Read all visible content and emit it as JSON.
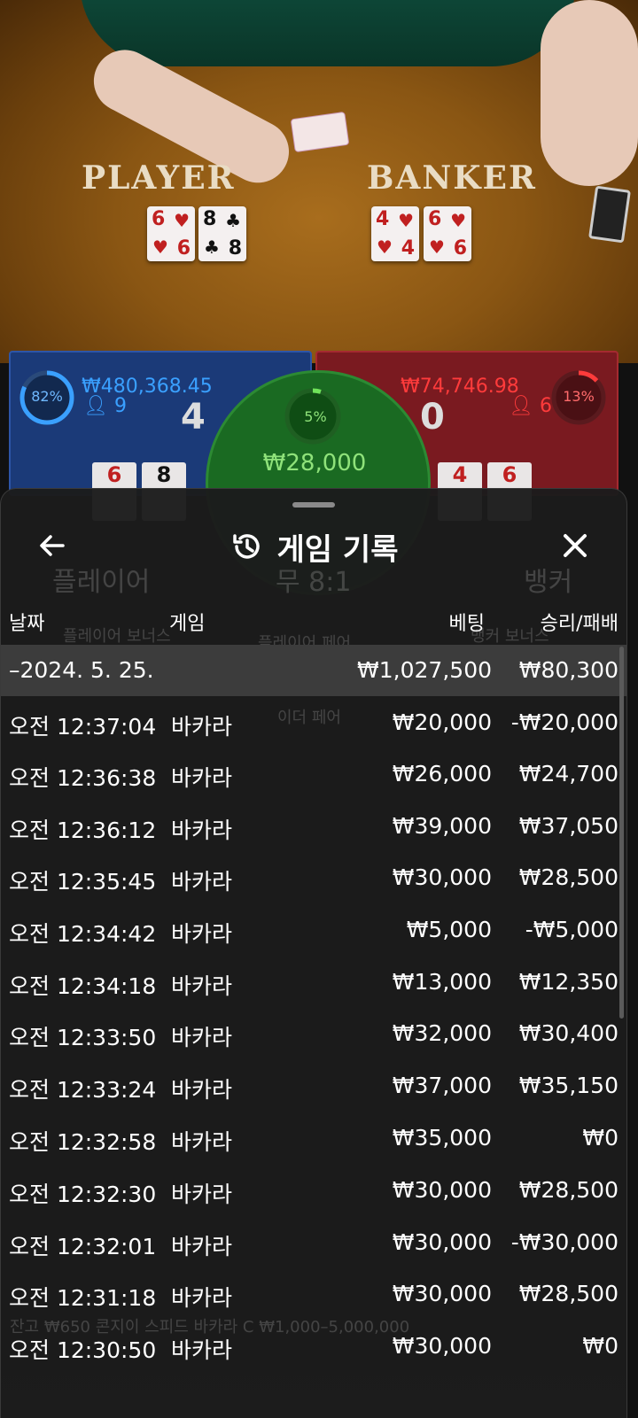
{
  "table": {
    "player_label": "PLAYER",
    "banker_label": "BANKER",
    "player_cards": [
      {
        "rank": "6",
        "suit": "♥",
        "color": "red"
      },
      {
        "rank": "8",
        "suit": "♣",
        "color": "black"
      }
    ],
    "banker_cards": [
      {
        "rank": "4",
        "suit": "♥",
        "color": "red"
      },
      {
        "rank": "6",
        "suit": "♥",
        "color": "red"
      }
    ]
  },
  "bets": {
    "player": {
      "percent": "82%",
      "amount": "₩480,368.45",
      "count": "9",
      "score": "4",
      "percent_value": 0.82,
      "color": "#3aa0ff"
    },
    "banker": {
      "percent": "13%",
      "amount": "₩74,746.98",
      "count": "6",
      "score": "0",
      "percent_value": 0.13,
      "color": "#ff3b3b"
    },
    "tie": {
      "percent": "5%",
      "amount": "₩28,000",
      "percent_value": 0.05,
      "color": "#6fe35a"
    },
    "player_mini_cards": [
      {
        "rank": "6",
        "suit": "♥"
      },
      {
        "rank": "8",
        "suit": "♣"
      }
    ],
    "banker_mini_cards": [
      {
        "rank": "4",
        "suit": "♥"
      },
      {
        "rank": "6",
        "suit": "♥"
      }
    ]
  },
  "background_ghost": {
    "player_tab": "플레이어",
    "tie_tab": "무 8:1",
    "banker_tab": "뱅커",
    "player_bonus": "플레이어 보너스",
    "banker_bonus": "뱅커 보너스",
    "player_pair": "플레이어 페어",
    "either_pair": "이더 페어",
    "footer": "잔고 ₩650   콘지이 스피드 바카라 C ₩1,000–5,000,000"
  },
  "modal": {
    "title": "게임 기록",
    "back_icon": "arrow-left-icon",
    "history_icon": "history-icon",
    "close_icon": "close-icon",
    "columns": {
      "date": "날짜",
      "game": "게임",
      "bet": "베팅",
      "result": "승리/패배"
    },
    "date_group": {
      "label": "–2024. 5. 25.",
      "bet": "₩1,027,500",
      "result": "₩80,300"
    },
    "rows": [
      {
        "time": "오전 12:37:04",
        "game": "바카라",
        "bet": "₩20,000",
        "result": "-₩20,000"
      },
      {
        "time": "오전 12:36:38",
        "game": "바카라",
        "bet": "₩26,000",
        "result": "₩24,700"
      },
      {
        "time": "오전 12:36:12",
        "game": "바카라",
        "bet": "₩39,000",
        "result": "₩37,050"
      },
      {
        "time": "오전 12:35:45",
        "game": "바카라",
        "bet": "₩30,000",
        "result": "₩28,500"
      },
      {
        "time": "오전 12:34:42",
        "game": "바카라",
        "bet": "₩5,000",
        "result": "-₩5,000"
      },
      {
        "time": "오전 12:34:18",
        "game": "바카라",
        "bet": "₩13,000",
        "result": "₩12,350"
      },
      {
        "time": "오전 12:33:50",
        "game": "바카라",
        "bet": "₩32,000",
        "result": "₩30,400"
      },
      {
        "time": "오전 12:33:24",
        "game": "바카라",
        "bet": "₩37,000",
        "result": "₩35,150"
      },
      {
        "time": "오전 12:32:58",
        "game": "바카라",
        "bet": "₩35,000",
        "result": "₩0"
      },
      {
        "time": "오전 12:32:30",
        "game": "바카라",
        "bet": "₩30,000",
        "result": "₩28,500"
      },
      {
        "time": "오전 12:32:01",
        "game": "바카라",
        "bet": "₩30,000",
        "result": "-₩30,000"
      },
      {
        "time": "오전 12:31:18",
        "game": "바카라",
        "bet": "₩30,000",
        "result": "₩28,500"
      },
      {
        "time": "오전 12:30:50",
        "game": "바카라",
        "bet": "₩30,000",
        "result": "₩0"
      }
    ]
  }
}
